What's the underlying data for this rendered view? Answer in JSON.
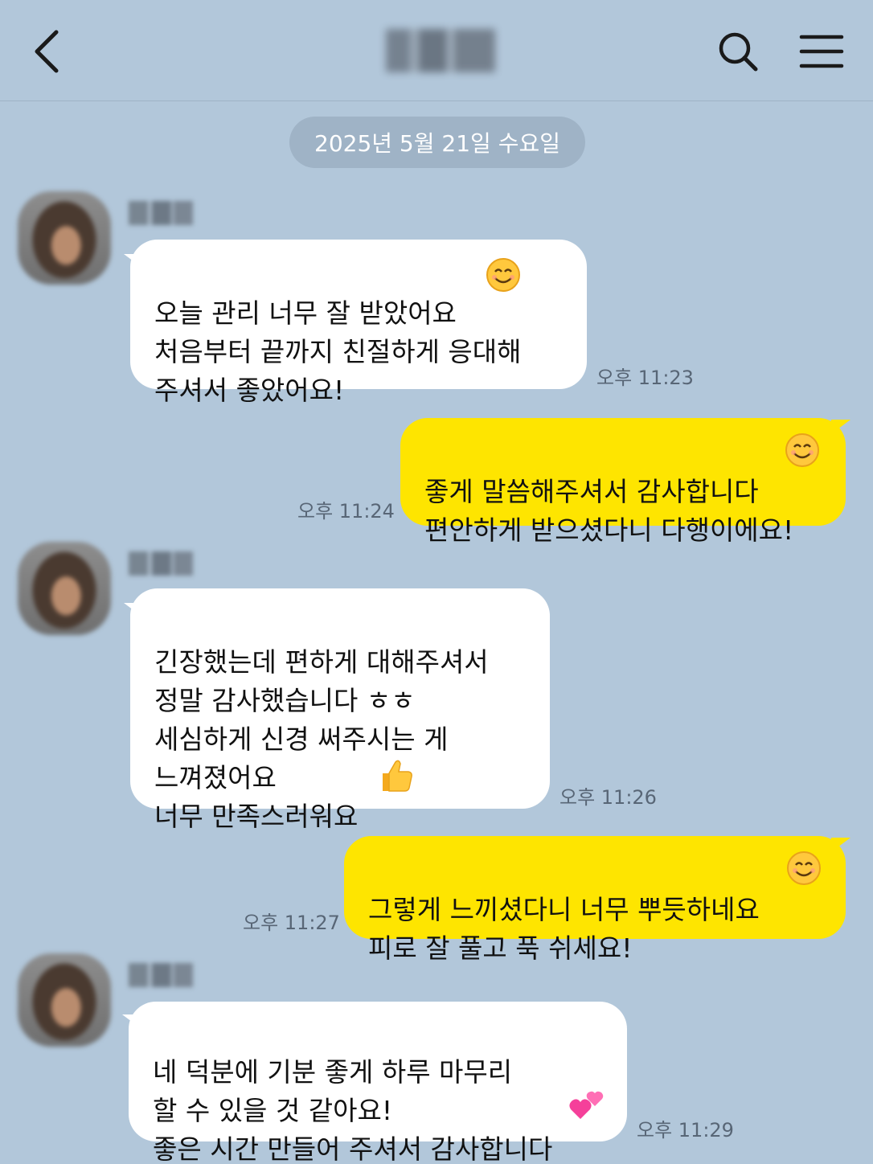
{
  "header": {
    "back_icon": "chevron-left-icon",
    "search_icon": "search-icon",
    "menu_icon": "hamburger-menu-icon"
  },
  "date_divider": "2025년 5월 21일 수요일",
  "messages": [
    {
      "direction": "incoming",
      "text": "오늘 관리 너무 잘 받았어요 \n처음부터 끝까지 친절하게 응대해\n주셔서 좋았어요!",
      "emoji": "smiling-face-icon",
      "time": "오후 11:23"
    },
    {
      "direction": "outgoing",
      "text": "좋게 말씀해주셔서 감사합니다 \n편안하게 받으셨다니 다행이에요!",
      "emoji": "smiling-face-icon",
      "time": "오후 11:24"
    },
    {
      "direction": "incoming",
      "text": "긴장했는데 편하게 대해주셔서\n정말 감사했습니다 ㅎㅎ\n세심하게 신경 써주시는 게\n느껴졌어요\n너무 만족스러워요 ",
      "emoji": "thumbs-up-icon",
      "time": "오후 11:26"
    },
    {
      "direction": "outgoing",
      "text": "그렇게 느끼셨다니 너무 뿌듯하네요 \n피로 잘 풀고 푹 쉬세요!",
      "emoji": "smiling-face-icon",
      "time": "오후 11:27"
    },
    {
      "direction": "incoming",
      "text": "네 덕분에 기분 좋게 하루 마무리\n할 수 있을 것 같아요!\n좋은 시간 만들어 주셔서 감사합니다 ",
      "emoji": "two-hearts-icon",
      "time": "오후 11:29"
    }
  ],
  "colors": {
    "background": "#b2c7da",
    "incoming_bubble": "#ffffff",
    "outgoing_bubble": "#fee500",
    "date_pill": "#9fb3c6",
    "time_text": "#586676"
  }
}
